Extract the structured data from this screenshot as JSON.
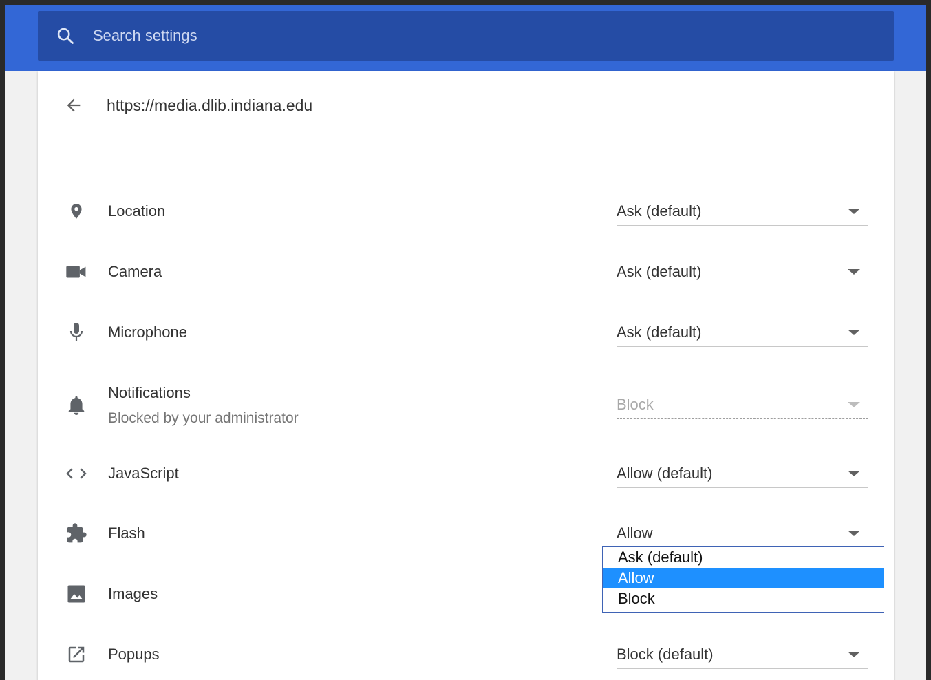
{
  "search": {
    "placeholder": "Search settings"
  },
  "site": {
    "url": "https://media.dlib.indiana.edu"
  },
  "permissions": [
    {
      "label": "Location",
      "value": "Ask (default)",
      "icon": "location-pin-icon"
    },
    {
      "label": "Camera",
      "value": "Ask (default)",
      "icon": "camera-icon"
    },
    {
      "label": "Microphone",
      "value": "Ask (default)",
      "icon": "microphone-icon"
    },
    {
      "label": "Notifications",
      "sublabel": "Blocked by your administrator",
      "value": "Block",
      "icon": "bell-icon",
      "disabled": true
    },
    {
      "label": "JavaScript",
      "value": "Allow (default)",
      "icon": "code-icon"
    },
    {
      "label": "Flash",
      "value": "Allow",
      "icon": "puzzle-icon"
    },
    {
      "label": "Images",
      "value": "",
      "icon": "image-icon"
    },
    {
      "label": "Popups",
      "value": "Block (default)",
      "icon": "open-in-new-icon"
    }
  ],
  "flash_dropdown": {
    "options": [
      "Ask (default)",
      "Allow",
      "Block"
    ],
    "selected": "Allow"
  },
  "colors": {
    "toolbar": "#3367d6",
    "search_bg": "#254ca5",
    "highlight": "#1e90ff"
  }
}
